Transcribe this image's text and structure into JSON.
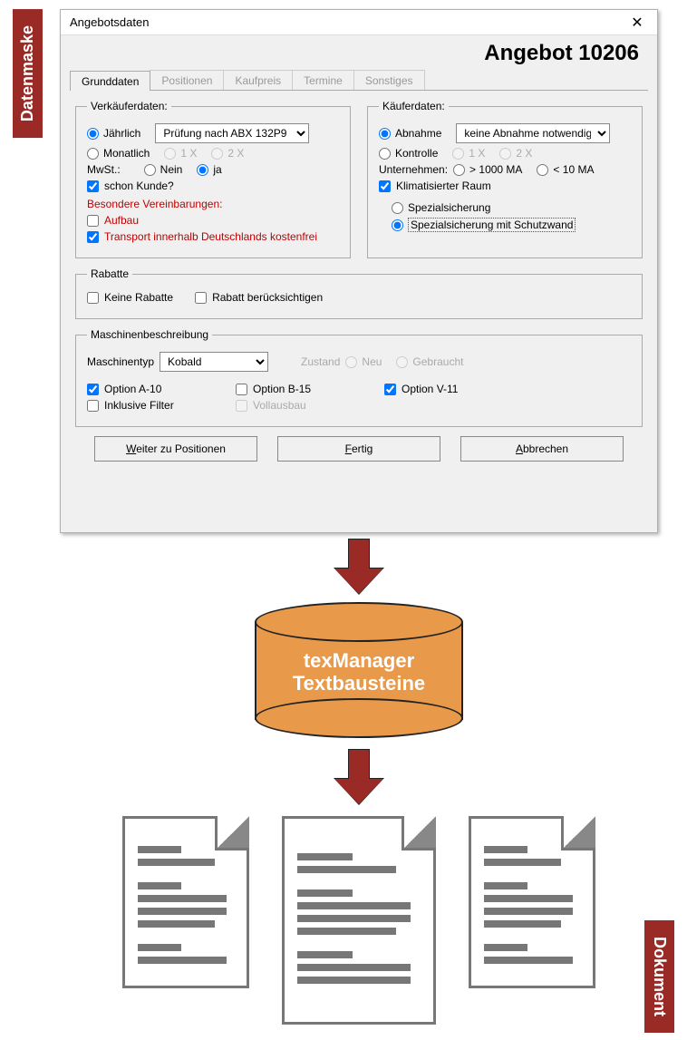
{
  "side_labels": {
    "left": "Datenmaske",
    "right": "Dokument"
  },
  "window": {
    "title": "Angebotsdaten",
    "headline": "Angebot 10206"
  },
  "tabs": {
    "active": "Grunddaten",
    "items": [
      "Grunddaten",
      "Positionen",
      "Kaufpreis",
      "Termine",
      "Sonstiges"
    ]
  },
  "seller": {
    "legend": "Verkäuferdaten:",
    "radio_year": "Jährlich",
    "radio_month": "Monatlich",
    "combo_year": "Prüfung nach ABX 132P9",
    "one_x": "1 X",
    "two_x": "2 X",
    "vat_label": "MwSt.:",
    "vat_no": "Nein",
    "vat_yes": "ja",
    "already_customer": "schon Kunde?",
    "bv_header": "Besondere Vereinbarungen:",
    "bv_aufbau": "Aufbau",
    "bv_transport": "Transport innerhalb Deutschlands kostenfrei"
  },
  "buyer": {
    "legend": "Käuferdaten:",
    "radio_abnahme": "Abnahme",
    "combo_abnahme": "keine Abnahme notwendig",
    "radio_kontrolle": "Kontrolle",
    "one_x": "1 X",
    "two_x": "2 X",
    "company_label": "Unternehmen:",
    "company_gt": "> 1000 MA",
    "company_lt": "< 10 MA",
    "ac_room": "Klimatisierter Raum",
    "spec1": "Spezialsicherung",
    "spec2": "Spezialsicherung mit Schutzwand"
  },
  "discounts": {
    "legend": "Rabatte",
    "none": "Keine Rabatte",
    "consider": "Rabatt berücksichtigen"
  },
  "machine": {
    "legend": "Maschinenbeschreibung",
    "type_label": "Maschinentyp",
    "type_value": "Kobald",
    "state_label": "Zustand",
    "state_new": "Neu",
    "state_used": "Gebraucht",
    "opt_a": "Option A-10",
    "opt_b": "Option B-15",
    "opt_v": "Option V-11",
    "incl_filter": "Inklusive Filter",
    "vollausbau": "Vollausbau"
  },
  "buttons": {
    "next_pre": "W",
    "next_rest": "eiter zu Positionen",
    "done_pre": "F",
    "done_rest": "ertig",
    "cancel_pre": "A",
    "cancel_rest": "bbrechen"
  },
  "cylinder": {
    "line1": "texManager",
    "line2": "Textbausteine"
  },
  "colors": {
    "brand_red": "#9a2a25",
    "orange": "#e8994a",
    "warn_red": "#c00000"
  }
}
